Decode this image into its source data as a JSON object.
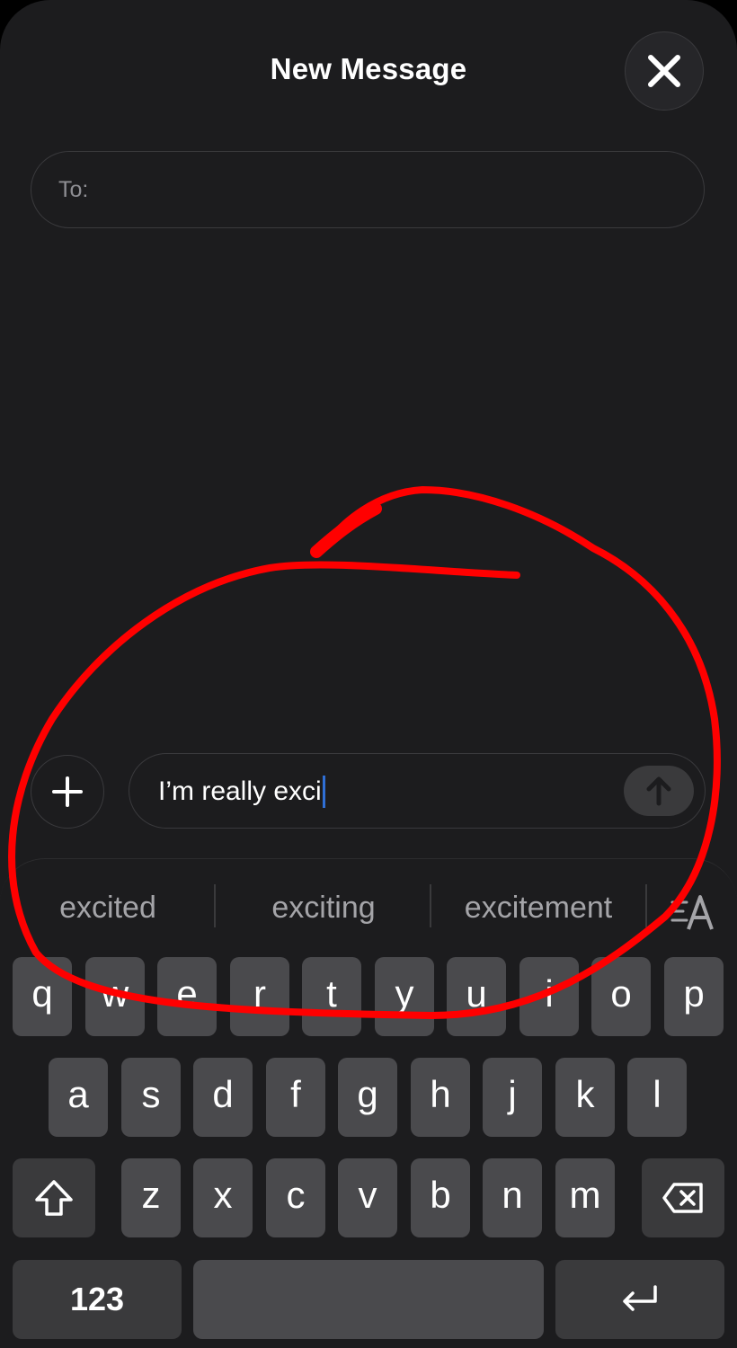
{
  "header": {
    "title": "New Message",
    "close_icon": "close-icon"
  },
  "recipient": {
    "label": "To:",
    "value": ""
  },
  "composer": {
    "add_icon": "plus-icon",
    "text": "I’m really exci",
    "send_icon": "arrow-up-icon"
  },
  "suggestions": {
    "items": [
      "excited",
      "exciting",
      "excitement"
    ],
    "format_icon": "text-format-icon"
  },
  "keyboard": {
    "row1": [
      "q",
      "w",
      "e",
      "r",
      "t",
      "y",
      "u",
      "i",
      "o",
      "p"
    ],
    "row2": [
      "a",
      "s",
      "d",
      "f",
      "g",
      "h",
      "j",
      "k",
      "l"
    ],
    "row3": [
      "z",
      "x",
      "c",
      "v",
      "b",
      "n",
      "m"
    ],
    "numbers_label": "123",
    "shift_icon": "shift-icon",
    "delete_icon": "delete-icon",
    "return_icon": "return-icon"
  },
  "annotation": {
    "color": "#ff0000",
    "shape": "hand-drawn circle"
  },
  "colors": {
    "background": "#1c1c1e",
    "key": "#4a4a4d",
    "caret": "#2f6fd6"
  }
}
